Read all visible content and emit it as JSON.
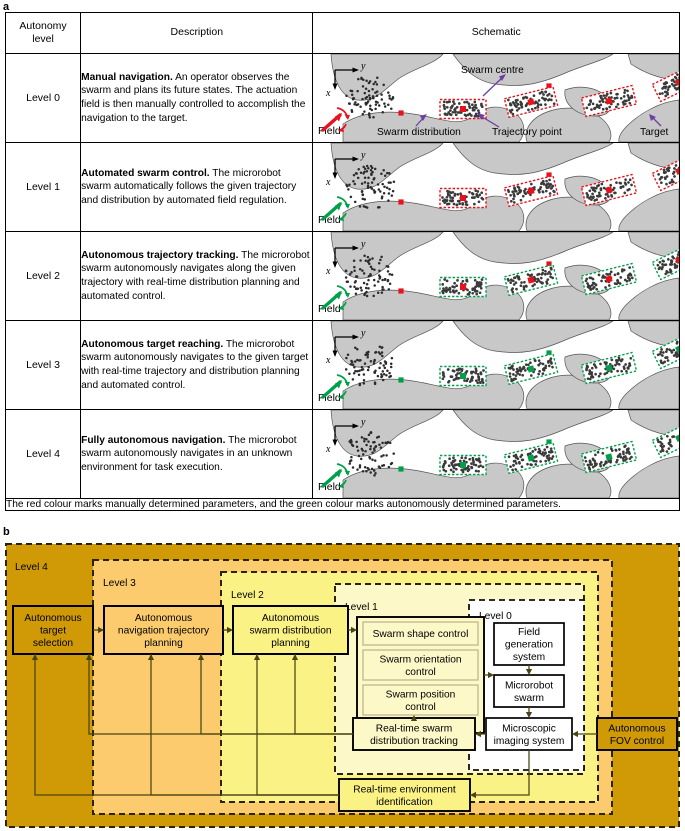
{
  "panels": {
    "a_letter": "a",
    "b_letter": "b"
  },
  "table": {
    "headers": {
      "level": "Autonomy\nlevel",
      "description": "Description",
      "schematic": "Schematic"
    },
    "header_level_line1": "Autonomy",
    "header_level_line2": "level",
    "header_description": "Description",
    "header_schematic": "Schematic",
    "rows": [
      {
        "level": "Level  0",
        "title": "Manual navigation.",
        "text": " An operator observes the swarm and plans its future states. The actuation field is then manually controlled to accomplish the navigation to the target."
      },
      {
        "level": "Level  1",
        "title": "Automated swarm control.",
        "text": " The microrobot swarm automatically follows the given trajectory and distribution by automated field regulation."
      },
      {
        "level": "Level  2",
        "title": "Autonomous trajectory tracking.",
        "text": " The microrobot swarm autonomously navigates along the given trajectory with real-time distribution planning and automated control."
      },
      {
        "level": "Level  3",
        "title": "Autonomous target reaching.",
        "text": " The microrobot swarm autonomously navigates to the given target with real-time trajectory and distribution planning and automated control."
      },
      {
        "level": "Level  4",
        "title": "Fully autonomous navigation.",
        "text": " The microrobot swarm autonomously navigates in an unknown environment for task execution."
      }
    ],
    "footnote": "The red colour marks manually determined parameters, and the green colour marks autonomously determined parameters."
  },
  "schematic": {
    "axis_x": "x",
    "axis_y": "y",
    "field_label": "Field",
    "annotations": {
      "swarm_centre": "Swarm centre",
      "swarm_distribution": "Swarm distribution",
      "trajectory_point": "Trajectory point",
      "target": "Target"
    },
    "colors": {
      "red": "#e8111c",
      "green": "#00a04a",
      "tissue_gray": "#c8c8c8",
      "robot_dark": "#3a3a3a",
      "annotation_arrow": "#6a3fa0"
    },
    "level_colors": [
      {
        "level": 0,
        "field": "#e8111c",
        "distribution": "#e8111c",
        "centre": "#e8111c",
        "trajectory": "#e8111c",
        "target": "#e8111c"
      },
      {
        "level": 1,
        "field": "#00a04a",
        "distribution": "#e8111c",
        "centre": "#e8111c",
        "trajectory": "#e8111c",
        "target": "#e8111c"
      },
      {
        "level": 2,
        "field": "#00a04a",
        "distribution": "#00a04a",
        "centre": "#e8111c",
        "trajectory": "#e8111c",
        "target": "#e8111c"
      },
      {
        "level": 3,
        "field": "#00a04a",
        "distribution": "#00a04a",
        "centre": "#00a04a",
        "trajectory": "#00a04a",
        "target": "#e8111c"
      },
      {
        "level": 4,
        "field": "#00a04a",
        "distribution": "#00a04a",
        "centre": "#00a04a",
        "trajectory": "#00a04a",
        "target": "#00a04a"
      }
    ]
  },
  "diagram": {
    "levels": [
      {
        "name": "Level 4",
        "color": "#cf9a06"
      },
      {
        "name": "Level 3",
        "color": "#fbcb6d"
      },
      {
        "name": "Level 2",
        "color": "#fbf285"
      },
      {
        "name": "Level 1",
        "color": "#fdf8c8"
      },
      {
        "name": "Level 0",
        "color": "#ffffff"
      }
    ],
    "boxes": {
      "autonomous_target_selection": "Autonomous\ntarget\nselection",
      "ats_l1": "Autonomous",
      "ats_l2": "target",
      "ats_l3": "selection",
      "navigation_planning_l1": "Autonomous",
      "navigation_planning_l2": "navigation trajectory",
      "navigation_planning_l3": "planning",
      "distribution_planning_l1": "Autonomous",
      "distribution_planning_l2": "swarm distribution",
      "distribution_planning_l3": "planning",
      "swarm_shape_control": "Swarm shape control",
      "swarm_orientation_l1": "Swarm orientation",
      "swarm_orientation_l2": "control",
      "swarm_position_l1": "Swarm position",
      "swarm_position_l2": "control",
      "field_generation_l1": "Field",
      "field_generation_l2": "generation",
      "field_generation_l3": "system",
      "microrobot_swarm_l1": "Microrobot",
      "microrobot_swarm_l2": "swarm",
      "microscopic_imaging_l1": "Microscopic",
      "microscopic_imaging_l2": "imaging system",
      "tracking_l1": "Real-time swarm",
      "tracking_l2": "distribution tracking",
      "environment_l1": "Real-time environment",
      "environment_l2": "identification",
      "fov_l1": "Autonomous",
      "fov_l2": "FOV control"
    }
  }
}
